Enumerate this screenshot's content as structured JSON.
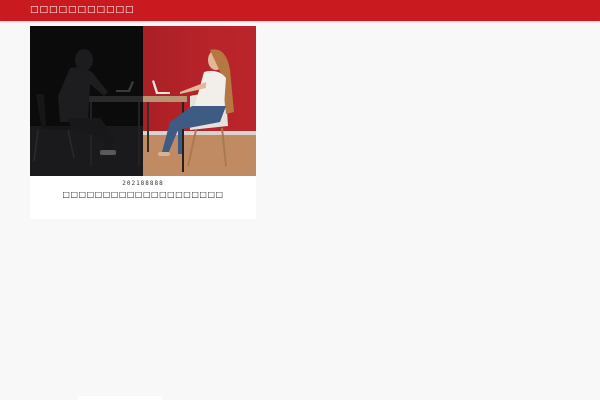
{
  "header": {
    "site_title": "□□□□□□□□□□□",
    "bar_color": "#c91b1f"
  },
  "article_card": {
    "date": "202188888",
    "title": "□□□□□□□□□□□□□□□□□□□□",
    "image_icon": "hacker-vs-woman-laptop-photo"
  }
}
